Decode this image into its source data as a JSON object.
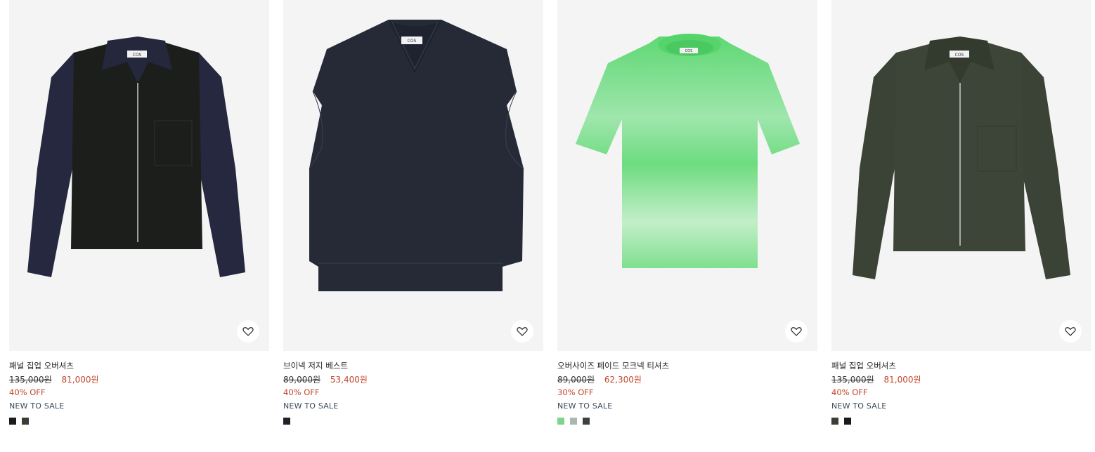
{
  "products": [
    {
      "name": "패널 집업 오버셔츠",
      "price_original": "135,000원",
      "price_sale": "81,000원",
      "discount": "40% OFF",
      "badge": "NEW TO SALE",
      "garment_colors": {
        "body": "#1c1e1c",
        "sleeve": "#26283f"
      },
      "swatches": [
        "#1a1a1a",
        "#3b3d35"
      ],
      "wishlist_icon": "heart-icon"
    },
    {
      "name": "브이넥 저지 베스트",
      "price_original": "89,000원",
      "price_sale": "53,400원",
      "discount": "40% OFF",
      "badge": "NEW TO SALE",
      "garment_colors": {
        "body": "#252a36"
      },
      "swatches": [
        "#1e2129"
      ],
      "wishlist_icon": "heart-icon"
    },
    {
      "name": "오버사이즈 페이드 모크넥 티셔츠",
      "price_original": "89,000원",
      "price_sale": "62,300원",
      "discount": "30% OFF",
      "badge": "NEW TO SALE",
      "garment_colors": {
        "body": "#66dd7a",
        "fade": "#c8f0cf"
      },
      "swatches": [
        "#7ed48e",
        "#a9b9b0",
        "#3e3f42"
      ],
      "wishlist_icon": "heart-icon"
    },
    {
      "name": "패널 집업 오버셔츠",
      "price_original": "135,000원",
      "price_sale": "81,000원",
      "discount": "40% OFF",
      "badge": "NEW TO SALE",
      "garment_colors": {
        "body": "#3a4336",
        "sleeve": "#3a4336"
      },
      "swatches": [
        "#3a3d36",
        "#1a1a1a"
      ],
      "wishlist_icon": "heart-icon"
    }
  ],
  "label_text": "COS"
}
